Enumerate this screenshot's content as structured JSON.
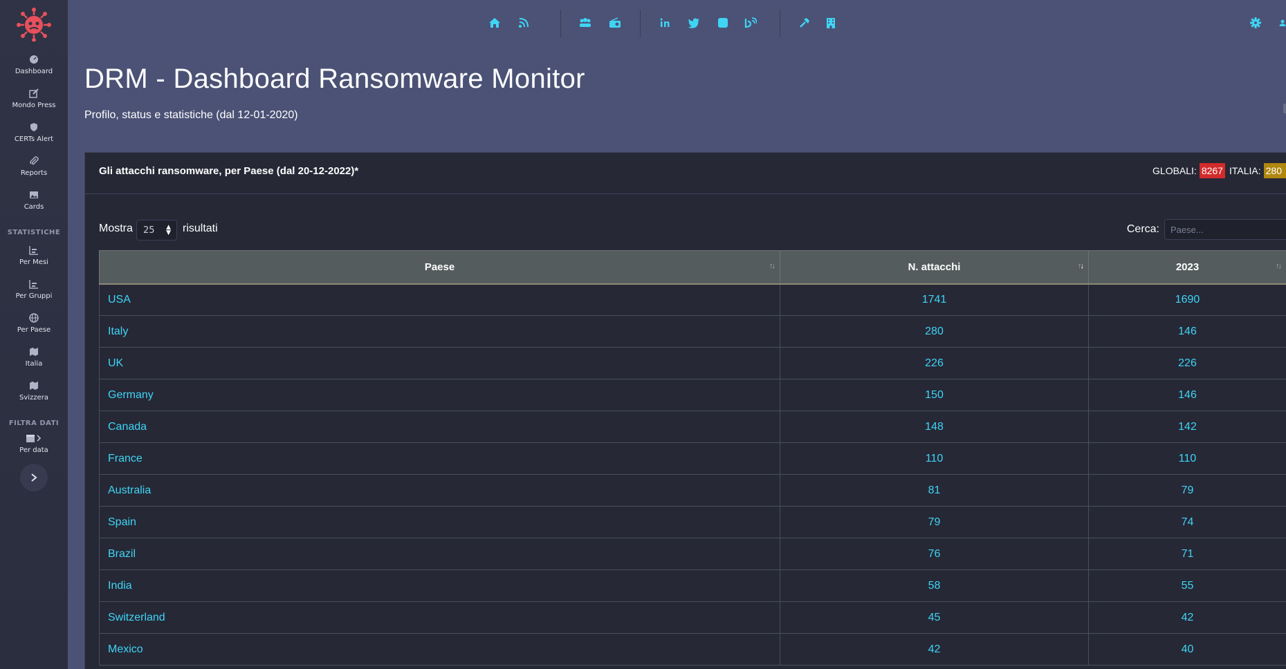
{
  "sidebar": {
    "items": [
      {
        "label": "Dashboard",
        "icon": "dashboard-icon"
      },
      {
        "label": "Mondo Press",
        "icon": "edit-icon"
      },
      {
        "label": "CERTs Alert",
        "icon": "shield-icon"
      },
      {
        "label": "Reports",
        "icon": "paperclip-icon"
      },
      {
        "label": "Cards",
        "icon": "image-icon"
      }
    ],
    "section_stats": "STATISTICHE",
    "stats_items": [
      {
        "label": "Per Mesi",
        "icon": "chart-icon"
      },
      {
        "label": "Per Gruppi",
        "icon": "chart-icon"
      },
      {
        "label": "Per Paese",
        "icon": "globe-icon"
      },
      {
        "label": "Italia",
        "icon": "map-icon"
      },
      {
        "label": "Svizzera",
        "icon": "map-icon"
      }
    ],
    "section_filter": "FILTRA DATI",
    "filter_item": {
      "label": "Per data",
      "icon": "calendar-icon"
    }
  },
  "header": {
    "title": "DRM - Dashboard Ransomware Monitor",
    "subtitle": "Profilo, status e statistiche (dal 12-01-2020)"
  },
  "card": {
    "title": "Gli attacchi ransomware, per Paese (dal 20-12-2022)*",
    "global_label": "GLOBALI:",
    "global_value": "8267",
    "italy_label": "ITALIA:",
    "italy_value": "280"
  },
  "controls": {
    "show_label": "Mostra",
    "show_value": "25",
    "results_label": "risultati",
    "search_label": "Cerca:",
    "search_placeholder": "Paese..."
  },
  "table": {
    "headers": [
      "Paese",
      "N. attacchi",
      "2023"
    ],
    "rows": [
      {
        "country": "USA",
        "attacks": "1741",
        "y2023": "1690"
      },
      {
        "country": "Italy",
        "attacks": "280",
        "y2023": "146"
      },
      {
        "country": "UK",
        "attacks": "226",
        "y2023": "226"
      },
      {
        "country": "Germany",
        "attacks": "150",
        "y2023": "146"
      },
      {
        "country": "Canada",
        "attacks": "148",
        "y2023": "142"
      },
      {
        "country": "France",
        "attacks": "110",
        "y2023": "110"
      },
      {
        "country": "Australia",
        "attacks": "81",
        "y2023": "79"
      },
      {
        "country": "Spain",
        "attacks": "79",
        "y2023": "74"
      },
      {
        "country": "Brazil",
        "attacks": "76",
        "y2023": "71"
      },
      {
        "country": "India",
        "attacks": "58",
        "y2023": "55"
      },
      {
        "country": "Switzerland",
        "attacks": "45",
        "y2023": "42"
      },
      {
        "country": "Mexico",
        "attacks": "42",
        "y2023": "40"
      }
    ]
  },
  "colors": {
    "background": "#4b5275",
    "sidebar": "#2f3345",
    "card": "#262836",
    "accent": "#3fd5f5",
    "badge_global": "#d22b2b",
    "badge_italy": "#b0870f"
  }
}
